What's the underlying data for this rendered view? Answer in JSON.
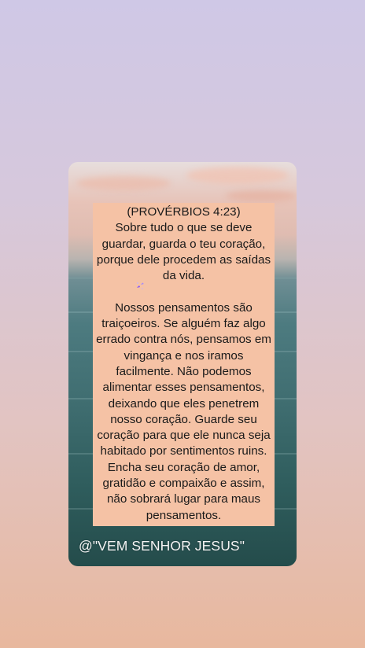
{
  "story": {
    "verse_reference": "(PROVÉRBIOS 4:23)",
    "verse_text": "Sobre tudo o que se deve\nguardar, guarda o teu coração,\nporque dele procedem as saídas\nda vida.",
    "reflection": "Nossos pensamentos são\ntraiçoeiros. Se alguém faz algo\nerrado contra nós, pensamos em\nvingança e nos iramos\nfacilmente. Não podemos\nalimentar esses pensamentos,\ndeixando que eles penetrem\nnosso coração. Guarde seu\ncoração para que ele nunca seja\nhabitado por sentimentos ruins.\nEncha seu coração de amor,\ngratidão e compaixão e assim,\nnão sobrará lugar para maus\npensamentos.",
    "emoji_icon": "sparkle-hearts-icon",
    "watermark": "@\"VEM SENHOR JESUS\""
  },
  "colors": {
    "text_box": "#f5c2a5",
    "watermark_text": "#f4f4f4",
    "emoji": "#8b5cf6"
  }
}
